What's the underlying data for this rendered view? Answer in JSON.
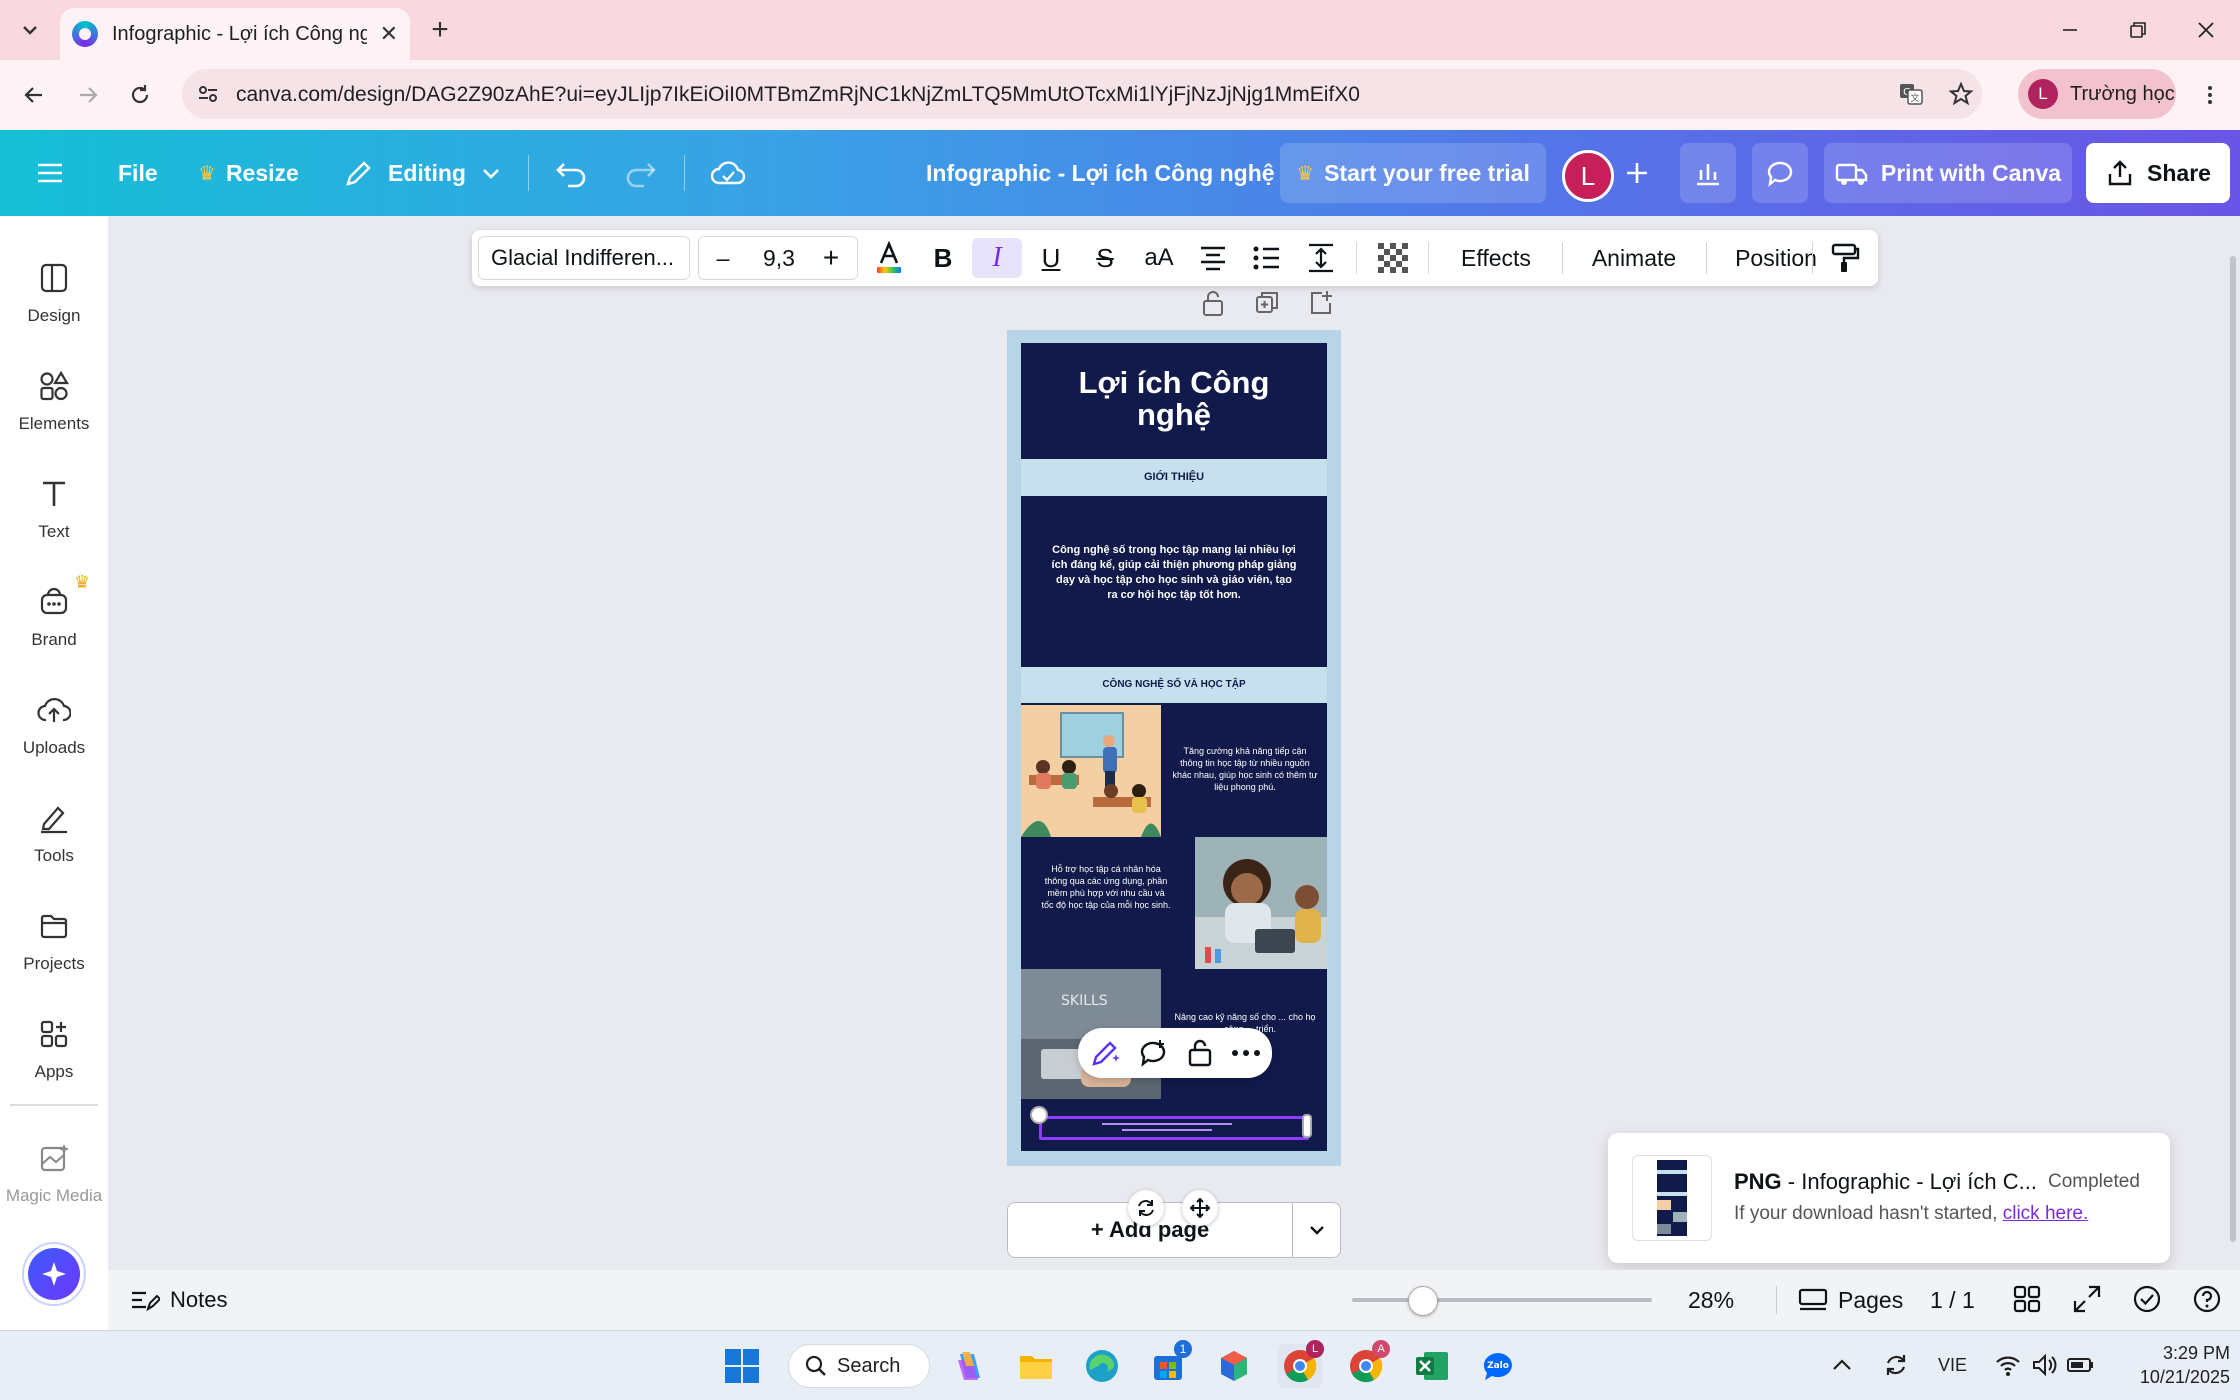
{
  "browser": {
    "tab_title": "Infographic - Lợi ích Công nghệ",
    "url": "canva.com/design/DAG2Z90zAhE?ui=eyJLIjp7IkEiOiI0MTBmZmRjNC1kNjZmLTQ5MmUtOTcxMi1lYjFjNzJjNjg1MmEifX0",
    "profile_initial": "L",
    "profile_name": "Trường học"
  },
  "canva_bar": {
    "file": "File",
    "resize": "Resize",
    "editing": "Editing",
    "doc_title": "Infographic - Lợi ích Công nghệ",
    "trial": "Start your free trial",
    "avatar": "L",
    "print": "Print with Canva",
    "share": "Share"
  },
  "sidebar": {
    "items": [
      {
        "label": "Design"
      },
      {
        "label": "Elements"
      },
      {
        "label": "Text"
      },
      {
        "label": "Brand"
      },
      {
        "label": "Uploads"
      },
      {
        "label": "Tools"
      },
      {
        "label": "Projects"
      },
      {
        "label": "Apps"
      },
      {
        "label": "Magic Media"
      }
    ]
  },
  "text_toolbar": {
    "font": "Glacial Indifferen...",
    "size": "9,3",
    "minus": "–",
    "plus": "+",
    "effects": "Effects",
    "animate": "Animate",
    "position": "Position"
  },
  "infographic": {
    "title_line1": "Lợi ích Công",
    "title_line2": "nghệ",
    "section1": "GIỚI THIỆU",
    "intro": "Công nghệ số trong học tập mang lại nhiều lợi ích đáng kể, giúp cải thiện phương pháp giảng dạy và học tập cho học sinh và giáo viên, tạo ra cơ hội học tập tốt hơn.",
    "section2": "CÔNG NGHỆ SỐ VÀ HỌC TẬP",
    "point1": "Tăng cường khả năng tiếp cận thông tin học tập từ nhiều nguồn khác nhau, giúp học sinh có thêm tư liệu phong phú.",
    "point2": "Hỗ trợ học tập cá nhân hóa thông qua các ứng dụng, phần mềm phù hợp với nhu cầu và tốc độ học tập của mỗi học sinh.",
    "point3": "Nâng cao kỹ năng số cho ... cho họ ... công ... triển."
  },
  "canvas": {
    "add_page": "+ Add page"
  },
  "bottom_bar": {
    "notes": "Notes",
    "zoom": "28%",
    "zoom_level": 0.28,
    "pages": "Pages",
    "page_count": "1 / 1"
  },
  "toast": {
    "format": "PNG",
    "filename": " - Infographic - Lợi ích C...",
    "status": "Completed",
    "hint": "If your download hasn't started, ",
    "link": "click here."
  },
  "taskbar": {
    "search": "Search",
    "lang": "VIE",
    "time": "3:29 PM",
    "date": "10/21/2025"
  },
  "colors": {
    "canva_gradient_start": "#15bfd6",
    "canva_gradient_end": "#6a55e6",
    "infographic_navy": "#111a4a",
    "infographic_band": "#c7e0ee",
    "link_purple": "#7d2ae8",
    "crown": "#ffc641"
  }
}
